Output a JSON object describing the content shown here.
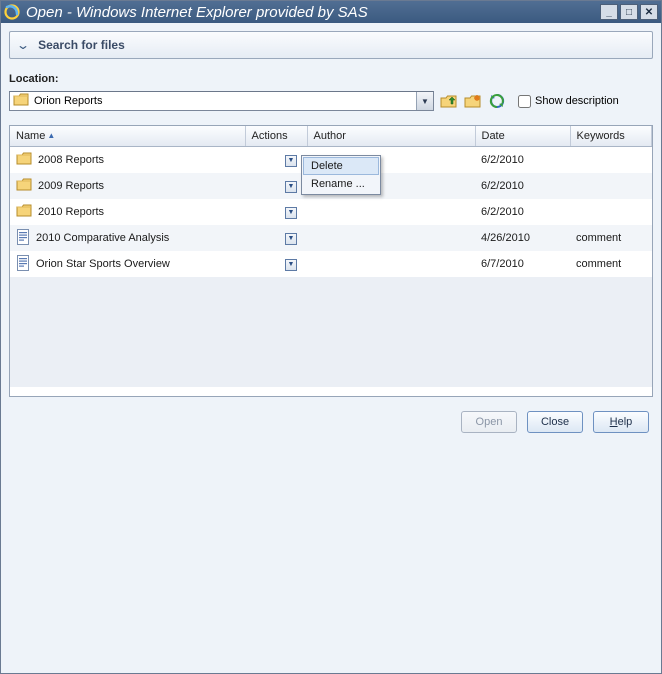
{
  "window": {
    "title": "Open - Windows Internet Explorer provided by SAS"
  },
  "search": {
    "label": "Search for files"
  },
  "location": {
    "label": "Location:",
    "folder": "Orion Reports",
    "show_description_label": "Show description"
  },
  "toolbar_icons": {
    "up": "up-folder-icon",
    "new": "new-folder-icon",
    "refresh": "refresh-icon"
  },
  "columns": {
    "name": "Name",
    "actions": "Actions",
    "author": "Author",
    "date": "Date",
    "keywords": "Keywords"
  },
  "rows": [
    {
      "icon": "folder",
      "name": "2008 Reports",
      "author": "",
      "date": "6/2/2010",
      "keywords": ""
    },
    {
      "icon": "folder",
      "name": "2009 Reports",
      "author": "",
      "date": "6/2/2010",
      "keywords": ""
    },
    {
      "icon": "folder",
      "name": "2010 Reports",
      "author": "",
      "date": "6/2/2010",
      "keywords": ""
    },
    {
      "icon": "doc",
      "name": "2010 Comparative Analysis",
      "author": "",
      "date": "4/26/2010",
      "keywords": "comment"
    },
    {
      "icon": "doc",
      "name": "Orion Star Sports Overview",
      "author": "",
      "date": "6/7/2010",
      "keywords": "comment"
    }
  ],
  "context_menu": {
    "items": [
      "Delete",
      "Rename ..."
    ]
  },
  "buttons": {
    "open": "Open",
    "close": "Close",
    "help": "Help"
  }
}
